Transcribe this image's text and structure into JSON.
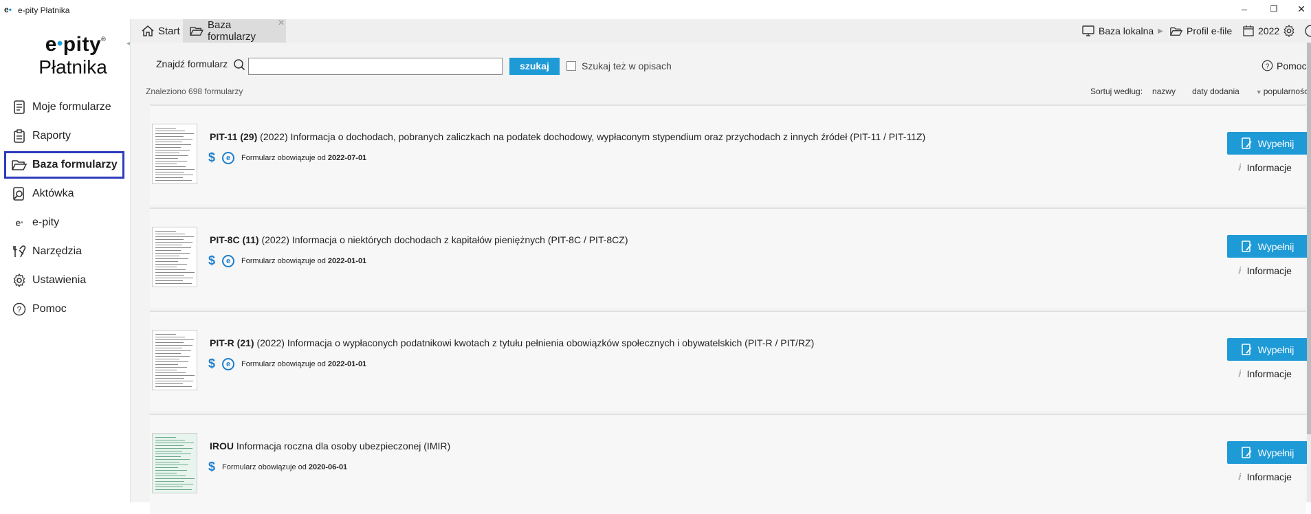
{
  "window": {
    "app_icon": "e",
    "title": "e-pity Płatnika",
    "minimize": "–",
    "restore": "❐",
    "close": "✕"
  },
  "logo": {
    "line1a": "e",
    "line1b": "pity",
    "reg": "®",
    "line2": "Płatnika"
  },
  "sidebar": {
    "items": [
      {
        "label": "Moje formularze",
        "icon": "document-icon"
      },
      {
        "label": "Raporty",
        "icon": "clipboard-icon"
      },
      {
        "label": "Baza formularzy",
        "icon": "folder-open-icon",
        "active": true
      },
      {
        "label": "Aktówka",
        "icon": "briefcase-search-icon"
      },
      {
        "label": "e-pity",
        "icon": "e-pity-icon"
      },
      {
        "label": "Narzędzia",
        "icon": "tools-icon"
      },
      {
        "label": "Ustawienia",
        "icon": "gear-icon"
      },
      {
        "label": "Pomoc",
        "icon": "question-icon"
      }
    ]
  },
  "tabs": [
    {
      "label": "Start",
      "icon": "home-icon"
    },
    {
      "label": "Baza formularzy",
      "icon": "folder-open-icon",
      "close": "✕"
    }
  ],
  "topbar": {
    "local_db": "Baza lokalna",
    "profile": "Profil e-file",
    "year": "2022"
  },
  "search": {
    "label": "Znajdź formularz",
    "value": "",
    "button": "szukaj",
    "checkbox_label": "Szukaj też w opisach",
    "help": "Pomoc"
  },
  "results": {
    "found_text": "Znaleziono 698 formularzy",
    "sort_label": "Sortuj według:",
    "sort_options": [
      "nazwy",
      "daty dodania",
      "popularności"
    ]
  },
  "forms": [
    {
      "code": "PIT-11 (29)",
      "desc": " (2022) Informacja o dochodach, pobranych zaliczkach na podatek dochodowy, wypłaconym stypendium oraz przychodach z innych źródeł  (PIT-11 / PIT-11Z)",
      "valid_text": "Formularz obowiązuje od",
      "valid_date": "2022-07-01",
      "eicon": true
    },
    {
      "code": "PIT-8C (11)",
      "desc": " (2022) Informacja o niektórych dochodach z kapitałów pieniężnych (PIT-8C / PIT-8CZ)",
      "valid_text": "Formularz obowiązuje od",
      "valid_date": "2022-01-01",
      "eicon": true
    },
    {
      "code": "PIT-R (21)",
      "desc": " (2022) Informacja o wypłaconych podatnikowi kwotach z tytułu pełnienia obowiązków społecznych i obywatelskich (PIT-R / PIT/RZ)",
      "valid_text": "Formularz obowiązuje od",
      "valid_date": "2022-01-01",
      "eicon": true
    },
    {
      "code": "IROU",
      "desc": " Informacja roczna dla osoby ubezpieczonej (IMIR)",
      "valid_text": "Formularz obowiązuje od",
      "valid_date": "2020-06-01",
      "eicon": false
    }
  ],
  "buttons": {
    "fill": "Wypełnij",
    "info": "Informacje"
  },
  "symbols": {
    "dollar": "$",
    "e": "e",
    "info_glyph": "ⅈ"
  },
  "colors": {
    "accent": "#1e9ad6",
    "active_border": "#2d3bbd"
  }
}
